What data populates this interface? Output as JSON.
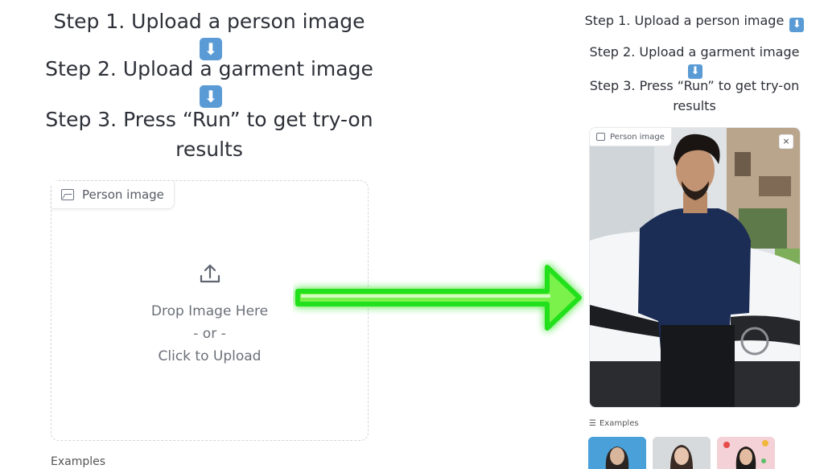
{
  "left": {
    "step1": "Step 1. Upload a person image",
    "step2": "Step 2. Upload a garment image",
    "step3": "Step 3. Press “Run” to get try-on results",
    "emoji": "⬇",
    "upload": {
      "tab_label": "Person image",
      "drop_text": "Drop Image Here",
      "or_text": "- or -",
      "click_text": "Click to Upload"
    },
    "examples_label": "Examples"
  },
  "right": {
    "step1": "Step 1. Upload a person image",
    "step2": "Step 2. Upload a garment image",
    "step3": "Step 3. Press “Run” to get try-on results",
    "emoji": "⬇",
    "photo_tab_label": "Person image",
    "close_symbol": "×",
    "examples_label": "Examples"
  },
  "colors": {
    "arrow": "#22e01e",
    "emoji_bg": "#5b9bd5",
    "border": "#d3d6db"
  }
}
